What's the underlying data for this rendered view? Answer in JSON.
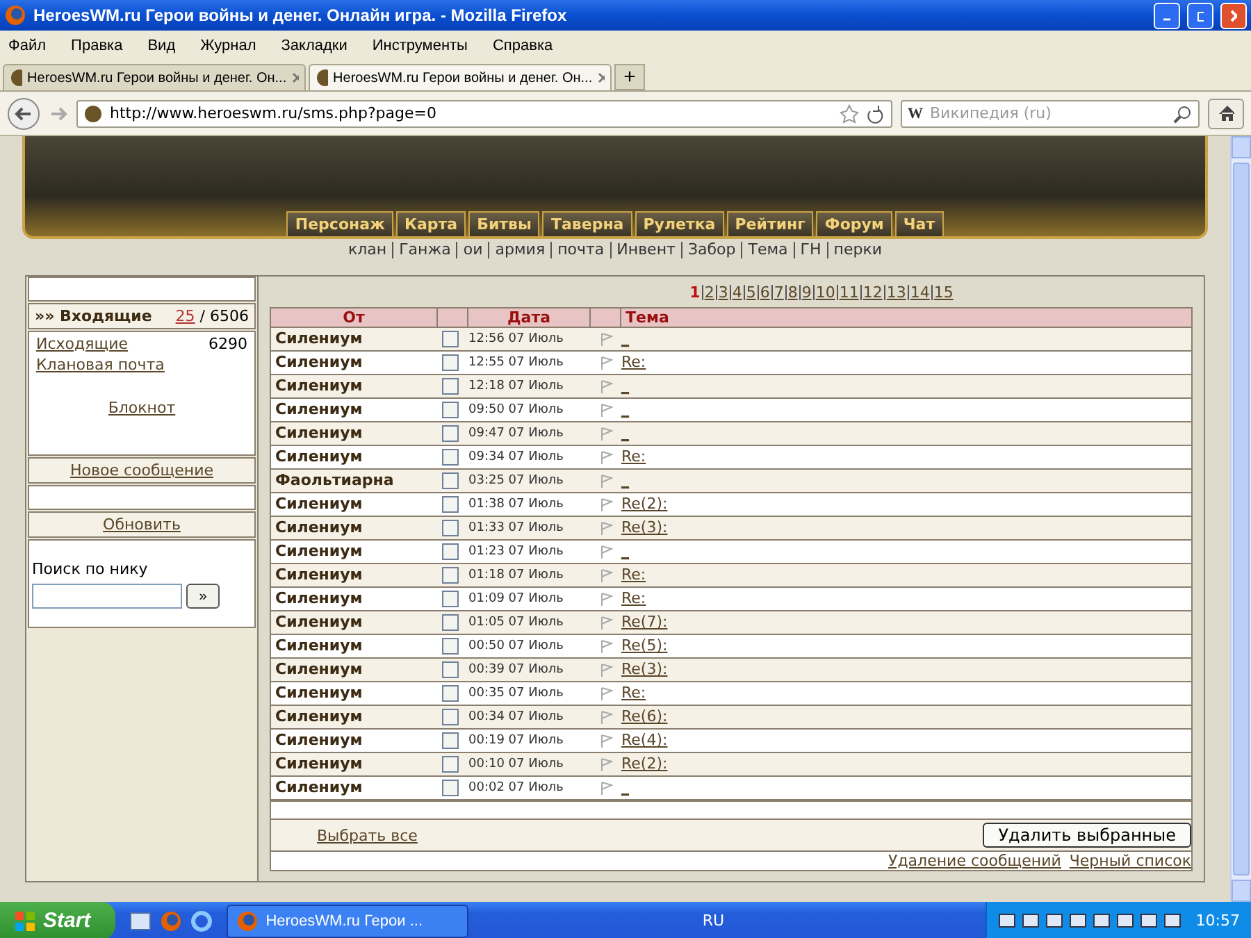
{
  "window": {
    "title": "HeroesWM.ru Герои войны и денег. Онлайн игра. - Mozilla Firefox"
  },
  "menu": [
    "Файл",
    "Правка",
    "Вид",
    "Журнал",
    "Закладки",
    "Инструменты",
    "Справка"
  ],
  "tabs": [
    {
      "label": "HeroesWM.ru Герои войны и денег. Он...",
      "selected": false
    },
    {
      "label": "HeroesWM.ru Герои войны и денег. Он...",
      "selected": true
    }
  ],
  "new_tab_button": "+",
  "address_bar": {
    "url": "http://www.heroeswm.ru/sms.php?page=0"
  },
  "search_field": {
    "engine": "W",
    "placeholder": "Википедия (ru)"
  },
  "game_nav": {
    "buttons": [
      "Персонаж",
      "Карта",
      "Битвы",
      "Таверна",
      "Рулетка",
      "Рейтинг",
      "Форум",
      "Чат"
    ],
    "links": [
      "клан",
      "Ганжа",
      "ои",
      "армия",
      "почта",
      "Инвент",
      "Забор",
      "Тема",
      "ГН",
      "перки"
    ]
  },
  "sidebar": {
    "inbox": {
      "label": "»» Входящие",
      "unread": "25",
      "total": "/ 6506"
    },
    "outbox": {
      "label": "Исходящие",
      "count": "6290"
    },
    "clan_mail": "Клановая почта",
    "notepad": "Блокнот",
    "new_message": "Новое сообщение",
    "refresh": "Обновить",
    "search": {
      "label": "Поиск по нику",
      "button": "»"
    }
  },
  "pages": [
    {
      "label": "1",
      "selected": true
    },
    {
      "label": "2",
      "selected": false
    },
    {
      "label": "3",
      "selected": false
    },
    {
      "label": "4",
      "selected": false
    },
    {
      "label": "5",
      "selected": false
    },
    {
      "label": "6",
      "selected": false
    },
    {
      "label": "7",
      "selected": false
    },
    {
      "label": "8",
      "selected": false
    },
    {
      "label": "9",
      "selected": false
    },
    {
      "label": "10",
      "selected": false
    },
    {
      "label": "11",
      "selected": false
    },
    {
      "label": "12",
      "selected": false
    },
    {
      "label": "13",
      "selected": false
    },
    {
      "label": "14",
      "selected": false
    },
    {
      "label": "15",
      "selected": false
    }
  ],
  "table": {
    "columns": [
      "От",
      "Дата",
      "Тема"
    ],
    "rows": [
      {
        "from": "Силениум",
        "time": "12:56 07 Июль",
        "subject": "_",
        "checked": false
      },
      {
        "from": "Силениум",
        "time": "12:55 07 Июль",
        "subject": "Re:",
        "checked": false
      },
      {
        "from": "Силениум",
        "time": "12:18 07 Июль",
        "subject": "_",
        "checked": false
      },
      {
        "from": "Силениум",
        "time": "09:50 07 Июль",
        "subject": "_",
        "checked": false
      },
      {
        "from": "Силениум",
        "time": "09:47 07 Июль",
        "subject": "_",
        "checked": false
      },
      {
        "from": "Силениум",
        "time": "09:34 07 Июль",
        "subject": "Re:",
        "checked": false
      },
      {
        "from": "Фаольтиарна",
        "time": "03:25 07 Июль",
        "subject": "_",
        "checked": false
      },
      {
        "from": "Силениум",
        "time": "01:38 07 Июль",
        "subject": "Re(2):",
        "checked": false
      },
      {
        "from": "Силениум",
        "time": "01:33 07 Июль",
        "subject": "Re(3):",
        "checked": false
      },
      {
        "from": "Силениум",
        "time": "01:23 07 Июль",
        "subject": "_",
        "checked": false
      },
      {
        "from": "Силениум",
        "time": "01:18 07 Июль",
        "subject": "Re:",
        "checked": false
      },
      {
        "from": "Силениум",
        "time": "01:09 07 Июль",
        "subject": "Re:",
        "checked": false
      },
      {
        "from": "Силениум",
        "time": "01:05 07 Июль",
        "subject": "Re(7):",
        "checked": false
      },
      {
        "from": "Силениум",
        "time": "00:50 07 Июль",
        "subject": "Re(5):",
        "checked": false
      },
      {
        "from": "Силениум",
        "time": "00:39 07 Июль",
        "subject": "Re(3):",
        "checked": false
      },
      {
        "from": "Силениум",
        "time": "00:35 07 Июль",
        "subject": "Re:",
        "checked": false
      },
      {
        "from": "Силениум",
        "time": "00:34 07 Июль",
        "subject": "Re(6):",
        "checked": false
      },
      {
        "from": "Силениум",
        "time": "00:19 07 Июль",
        "subject": "Re(4):",
        "checked": false
      },
      {
        "from": "Силениум",
        "time": "00:10 07 Июль",
        "subject": "Re(2):",
        "checked": false
      },
      {
        "from": "Силениум",
        "time": "00:02 07 Июль",
        "subject": "_",
        "checked": false
      }
    ]
  },
  "select_all": "Выбрать все",
  "delete_button": "Удалить выбранные",
  "bottom_links": [
    "Удаление сообщений",
    "Черный список"
  ],
  "taskbar": {
    "start": "Start",
    "task": "HeroesWM.ru Герои ...",
    "language": "RU",
    "clock": "10:57"
  }
}
